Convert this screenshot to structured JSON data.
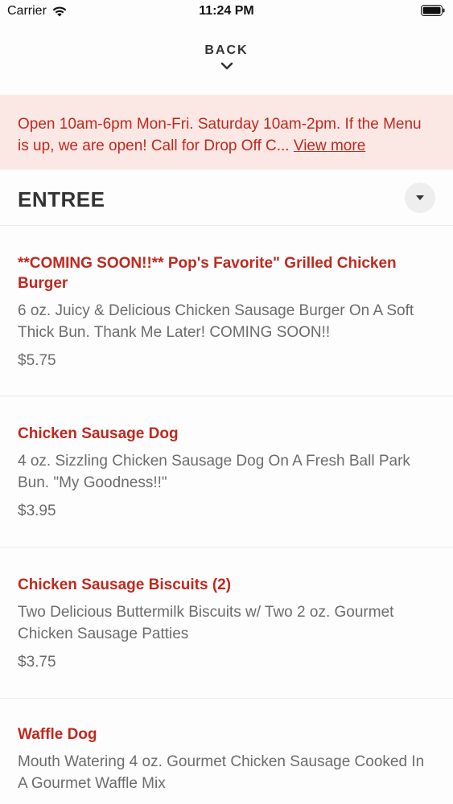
{
  "status_bar": {
    "carrier": "Carrier",
    "time": "11:24 PM"
  },
  "nav": {
    "back_label": "BACK"
  },
  "notice": {
    "text": "Open 10am-6pm Mon-Fri. Saturday 10am-2pm. If the Menu is up, we are open! Call for Drop Off C...",
    "link_label": "View more"
  },
  "section": {
    "title": "ENTREE"
  },
  "items": [
    {
      "name": "**COMING SOON!!** Pop's Favorite\" Grilled Chicken Burger",
      "description": "6 oz. Juicy & Delicious Chicken Sausage Burger On A Soft Thick Bun. Thank Me Later! COMING SOON!!",
      "price": "$5.75"
    },
    {
      "name": "Chicken Sausage Dog",
      "description": "4 oz. Sizzling Chicken Sausage Dog On A Fresh Ball Park Bun. \"My Goodness!!\"",
      "price": "$3.95"
    },
    {
      "name": "Chicken Sausage Biscuits (2)",
      "description": "Two Delicious Buttermilk Biscuits w/ Two 2 oz. Gourmet Chicken Sausage Patties",
      "price": "$3.75"
    },
    {
      "name": "Waffle Dog",
      "description": "Mouth Watering 4 oz. Gourmet Chicken Sausage Cooked In A Gourmet Waffle Mix",
      "price": ""
    }
  ],
  "colors": {
    "accent": "#c0281e",
    "notice_bg": "#fbe8e4",
    "muted_text": "#6c6c6c"
  },
  "icons": [
    "wifi-icon",
    "battery-icon",
    "chevron-down-icon",
    "dropdown-arrow-icon"
  ]
}
